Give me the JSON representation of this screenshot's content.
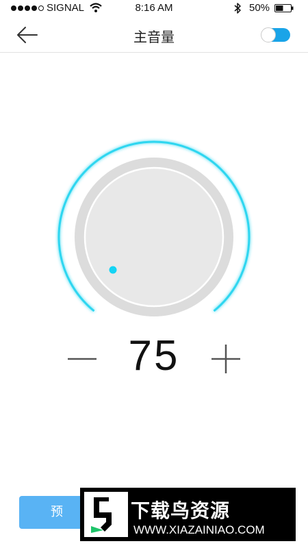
{
  "status_bar": {
    "carrier": "SIGNAL",
    "time": "8:16 AM",
    "battery_percent_text": "50%",
    "battery_level": 0.5,
    "signal_strength": 4,
    "signal_max": 5
  },
  "nav": {
    "back_icon": "arrow-left-icon",
    "title": "主音量",
    "toggle_on": true
  },
  "volume": {
    "value": "75",
    "minus_icon": "minus-icon",
    "plus_icon": "plus-icon"
  },
  "bottom_button": {
    "label": "预"
  },
  "watermark": {
    "name": "下载鸟资源",
    "url": "WWW.XIAZAINIAO.COM"
  },
  "colors": {
    "accent": "#1aa4e8",
    "arc": "#2fd6f0",
    "knob": "#e2e2e2",
    "button": "#59b3f4"
  }
}
